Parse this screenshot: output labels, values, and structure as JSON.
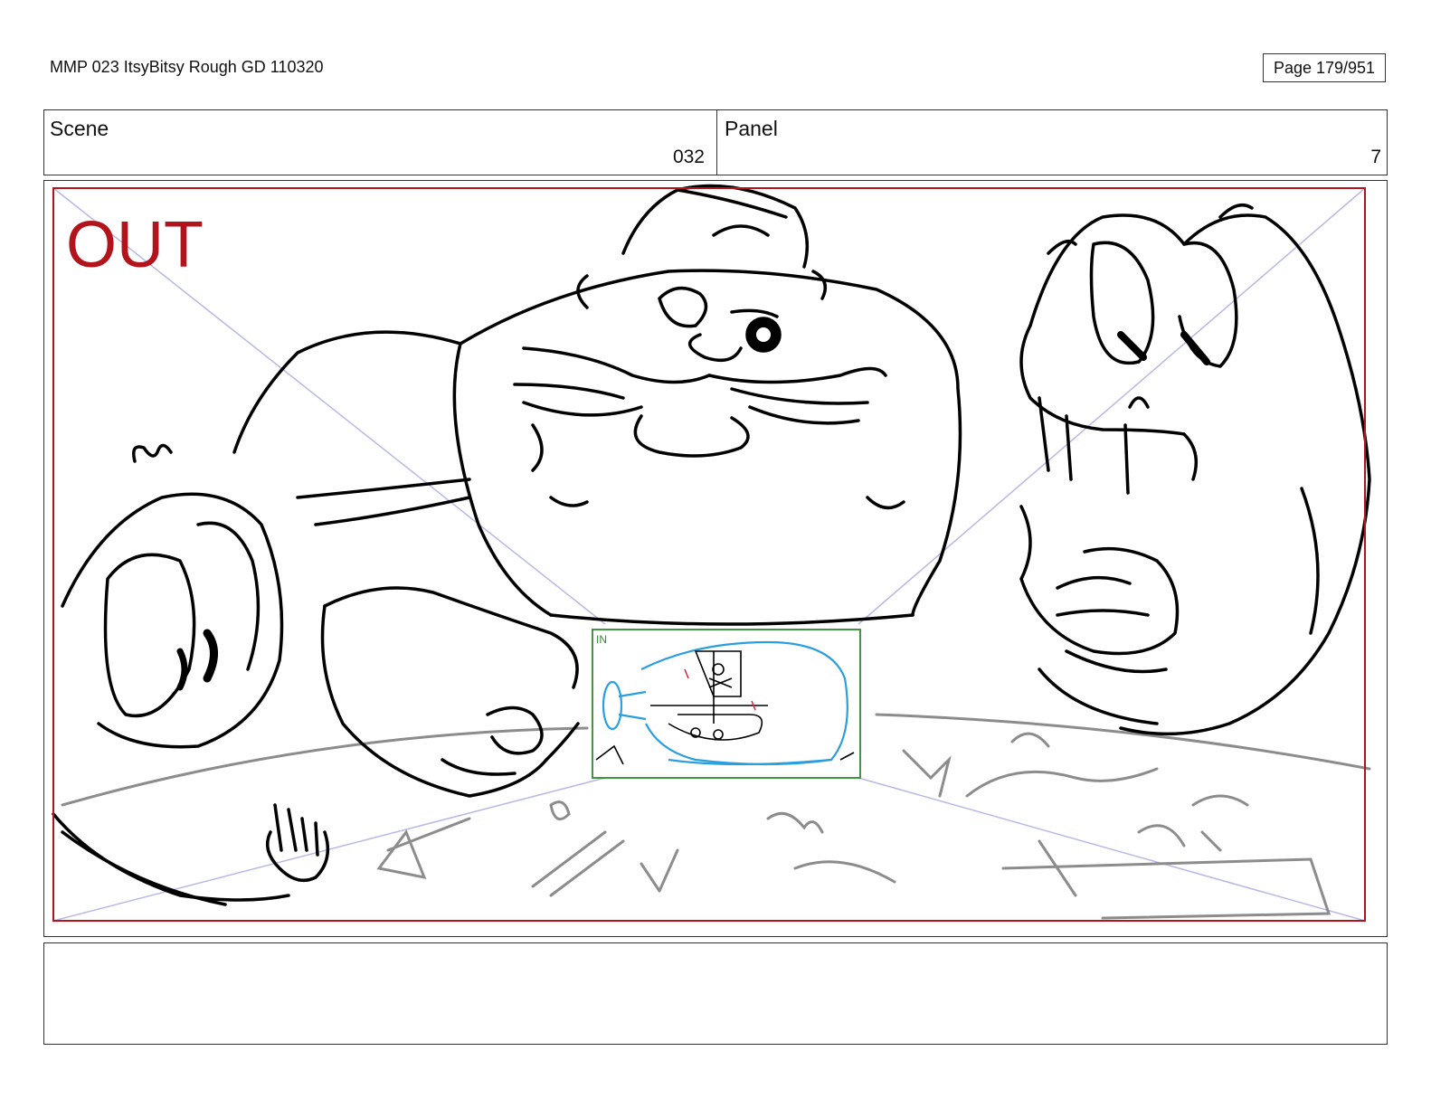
{
  "header": {
    "doc_title": "MMP 023 ItsyBitsy Rough GD 110320",
    "page_label": "Page 179/951"
  },
  "scene": {
    "label": "Scene",
    "value": "032"
  },
  "panel": {
    "label": "Panel",
    "value": "7"
  },
  "frame": {
    "out_label": "OUT",
    "in_label": "IN"
  },
  "colors": {
    "out_frame": "#b3141c",
    "in_frame": "#2e8b2e",
    "bottle": "#2a9fe0",
    "guide_lines": "#b8b8e6",
    "ink": "#000000",
    "pencil": "#8c8c8c"
  },
  "notes": {
    "text": ""
  }
}
